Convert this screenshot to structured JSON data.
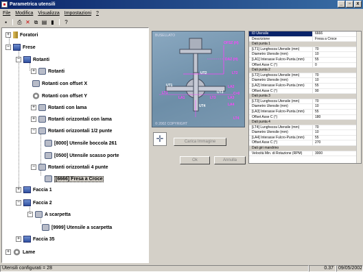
{
  "window": {
    "title": "Parametrica utensili",
    "buttons": [
      "_",
      "▫",
      "x"
    ]
  },
  "menu": [
    "File",
    "Modifica",
    "Visualizza",
    "Impostazioni",
    "?"
  ],
  "toolbar": {
    "icons": [
      "save-icon",
      "print-icon",
      "delete-icon",
      "copy-icon",
      "paste-icon",
      "chart-icon",
      "help-icon"
    ]
  },
  "tree": {
    "foratori": "Foratori",
    "frese": "Frese",
    "rotanti": "Rotanti",
    "rotanti_child": "Rotanti",
    "offset_x": "Rotanti con offset X",
    "offset_y": "Rotanti con offset Y",
    "lama": "Rotanti con lama",
    "oriz_lama": "Rotanti orizzontali con lama",
    "oriz_half": "Rotanti orizzontali 1/2 punte",
    "tool8000": "[8000] Utensile boccola 261",
    "tool0500": "[0500] Utensile scasso porte",
    "oriz4": "Rotanti orizzontali 4 punte",
    "tool6666": "[6666] Fresa a Croce",
    "faccia1": "Faccia 1",
    "faccia2": "Faccia 2",
    "scarpetta": "A scarpetta",
    "tool9999": "[9999] Utensile a scarpetta",
    "faccia35": "Faccia 35",
    "lame": "Lame"
  },
  "viewer": {
    "watermark": "BUSELLATO",
    "copyright": "© 2002 COPYRIGHT",
    "labels": [
      "OFSZ (H)",
      "DAZ (H)",
      "LT2",
      "LA2",
      "LT1",
      "LA1",
      "LT3",
      "LA3",
      "UT2",
      "UT1",
      "UT3",
      "UT4",
      "LA4",
      "C=0",
      "LT4"
    ]
  },
  "buttons": {
    "carica": "Carica Immagine",
    "ok": "Ok",
    "annulla": "Annulla"
  },
  "properties": [
    {
      "k": "ID Utensile",
      "v": "6666",
      "type": "sel"
    },
    {
      "k": "Descrizione",
      "v": "Fresa a Croce"
    },
    {
      "k": "Dati punta 1",
      "v": "",
      "type": "cat"
    },
    {
      "k": "[LT1] Lunghezza Utensile (mm)",
      "v": "70"
    },
    {
      "k": "Diametro Utensile (mm)",
      "v": "10"
    },
    {
      "k": "[LA1] Interasse Fulcro-Punta (mm)",
      "v": "55"
    },
    {
      "k": "Offset Asse C (°)",
      "v": "0"
    },
    {
      "k": "Dati punta 2",
      "v": "",
      "type": "cat"
    },
    {
      "k": "[LT2] Lunghezza Utensile (mm)",
      "v": "70"
    },
    {
      "k": "Diametro Utensile (mm)",
      "v": "10"
    },
    {
      "k": "[LA2] Interasse Fulcro-Punta (mm)",
      "v": "55"
    },
    {
      "k": "Offset Asse C (°)",
      "v": "90"
    },
    {
      "k": "Dati punta 3",
      "v": "",
      "type": "cat"
    },
    {
      "k": "[LT3] Lunghezza Utensile (mm)",
      "v": "70"
    },
    {
      "k": "Diametro Utensile (mm)",
      "v": "10"
    },
    {
      "k": "[LA3] Interasse Fulcro-Punta (mm)",
      "v": "55"
    },
    {
      "k": "Offset Asse C (°)",
      "v": "180"
    },
    {
      "k": "Dati punta 4",
      "v": "",
      "type": "cat"
    },
    {
      "k": "[LT4] Lunghezza Utensile (mm)",
      "v": "70"
    },
    {
      "k": "Diametro Utensile (mm)",
      "v": "10"
    },
    {
      "k": "[LA4] Interasse Fulcro-Punta (mm)",
      "v": "55"
    },
    {
      "k": "Offset Asse C (°)",
      "v": "270"
    },
    {
      "k": "Dati giri mandrino",
      "v": "",
      "type": "cat"
    },
    {
      "k": "Velocità Min. di Rotazione (RPM)",
      "v": "3000"
    }
  ],
  "status": {
    "count": "Utensili configurati = 28",
    "version": "0.37",
    "date": "09/05/2002"
  }
}
